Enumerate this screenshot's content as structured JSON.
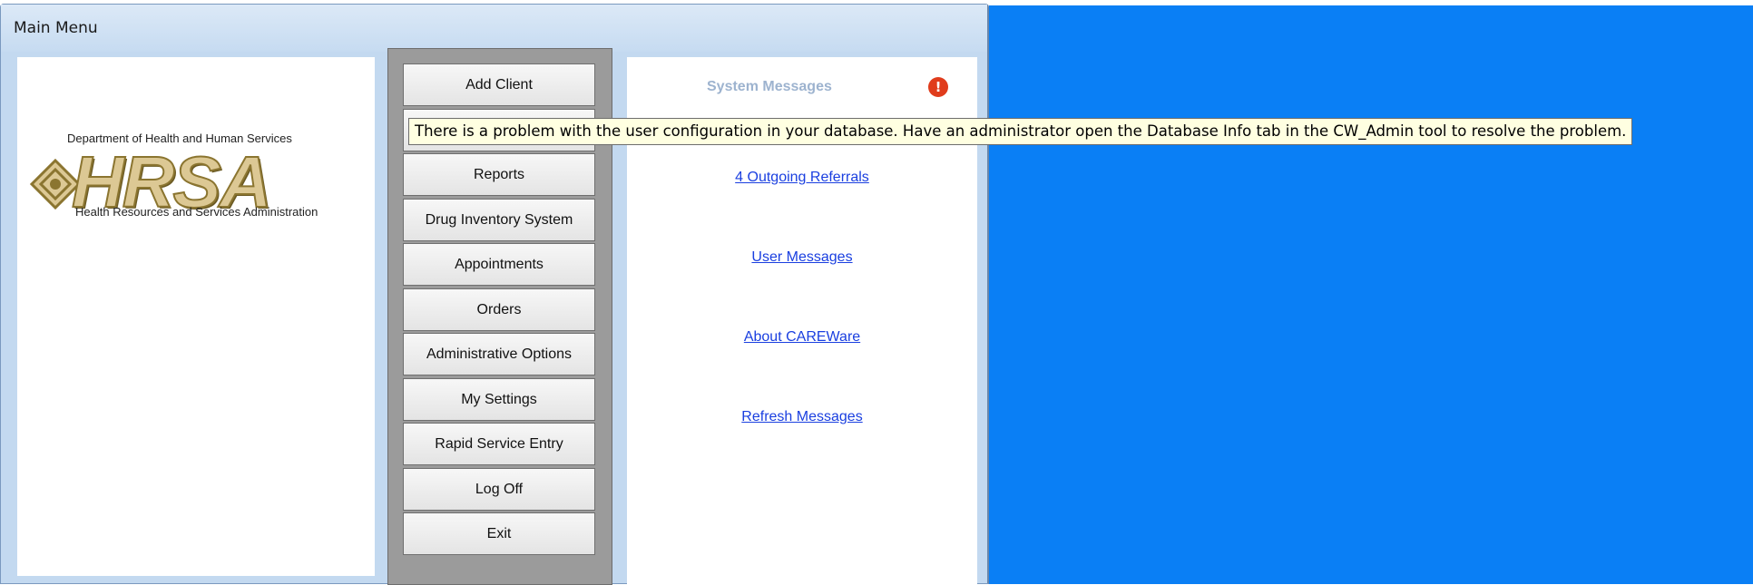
{
  "window": {
    "title": "Main Menu"
  },
  "logo": {
    "department": "Department of Health and Human Services",
    "wordmark": "HRSA",
    "subtitle": "Health Resources and Services Administration"
  },
  "menu": {
    "items": [
      {
        "label": "Add Client"
      },
      {
        "label": ""
      },
      {
        "label": "Reports"
      },
      {
        "label": "Drug Inventory System"
      },
      {
        "label": "Appointments"
      },
      {
        "label": "Orders"
      },
      {
        "label": "Administrative Options"
      },
      {
        "label": "My Settings"
      },
      {
        "label": "Rapid Service Entry"
      },
      {
        "label": "Log Off"
      },
      {
        "label": "Exit"
      }
    ]
  },
  "messages": {
    "title": "System Messages",
    "alert_icon": "alert-icon",
    "links": [
      {
        "label": "4  Outgoing Referrals"
      },
      {
        "label": "User Messages"
      },
      {
        "label": "About CAREWare"
      },
      {
        "label": "Refresh Messages"
      }
    ]
  },
  "tooltip": {
    "text": "There is a problem with the user configuration in your database. Have an administrator open the Database Info tab in the CW_Admin tool to resolve the problem."
  },
  "colors": {
    "desktop": "#0a7ff5",
    "window_frame": "#c3d9f0",
    "menu_panel": "#9b9b9b",
    "link": "#1a3fe0",
    "alert": "#e03c1c",
    "tooltip_bg": "#ffffe1"
  }
}
